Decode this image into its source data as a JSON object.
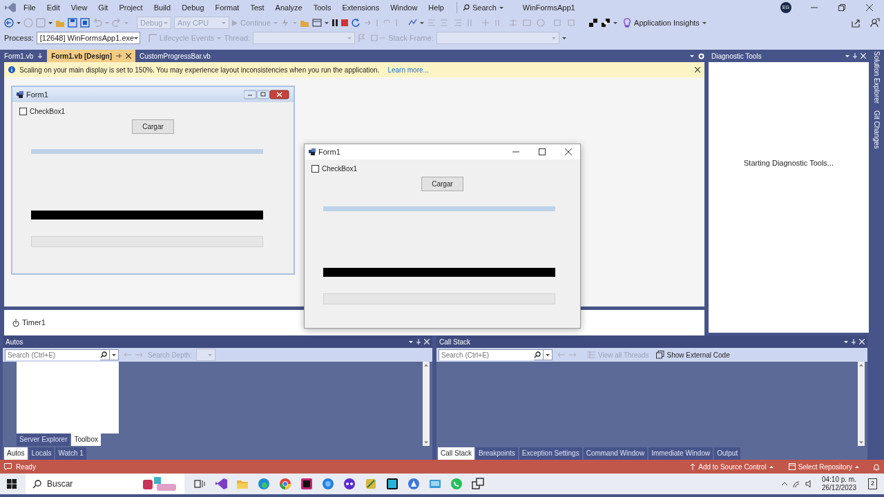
{
  "menu": [
    "File",
    "Edit",
    "View",
    "Git",
    "Project",
    "Build",
    "Debug",
    "Format",
    "Test",
    "Analyze",
    "Tools",
    "Extensions",
    "Window",
    "Help"
  ],
  "search": "Search",
  "solution": "WinFormsApp1",
  "account": "EG",
  "toolbar": {
    "config": "Debug",
    "platform": "Any CPU",
    "continue": "Continue",
    "insights": "Application Insights"
  },
  "debug_location": {
    "process_label": "Process:",
    "process": "[12648] WinFormsApp1.exe",
    "lifecycle": "Lifecycle Events",
    "thread_label": "Thread:",
    "frame_label": "Stack Frame:"
  },
  "doc_tabs": [
    {
      "label": "Form1.vb",
      "selected": false
    },
    {
      "label": "Form1.vb [Design]",
      "selected": true
    },
    {
      "label": "CustomProgressBar.vb",
      "selected": false
    }
  ],
  "info_bar": {
    "message": "Scaling on your main display is set to 150%. You may experience layout inconsistencies when you run the application.",
    "link": "Learn more..."
  },
  "designer_form": {
    "title": "Form1",
    "checkbox": {
      "label": "CheckBox1",
      "checked": false
    },
    "button": "Cargar",
    "bars": [
      {
        "kind": "thin",
        "level": 1
      },
      {
        "kind": "solid",
        "level": 1
      },
      {
        "kind": "empty",
        "level": 0
      }
    ]
  },
  "component_tray": [
    "Timer1"
  ],
  "running_form": {
    "title": "Form1",
    "checkbox": {
      "label": "CheckBox1",
      "checked": false
    },
    "button": "Cargar",
    "bars": [
      {
        "kind": "thin",
        "level": 1
      },
      {
        "kind": "solid",
        "level": 1
      },
      {
        "kind": "empty",
        "level": 0
      }
    ]
  },
  "diagnostics": {
    "title": "Diagnostic Tools",
    "message": "Starting Diagnostic Tools..."
  },
  "side_tabs": [
    "Solution Explorer",
    "Git Changes"
  ],
  "autos": {
    "title": "Autos",
    "search_placeholder": "Search (Ctrl+E)",
    "depth_label": "Search Depth:",
    "popup_tabs": [
      {
        "label": "Server Explorer",
        "selected": false
      },
      {
        "label": "Toolbox",
        "selected": true
      }
    ],
    "tabs": [
      {
        "label": "Autos",
        "selected": true
      },
      {
        "label": "Locals",
        "selected": false
      },
      {
        "label": "Watch 1",
        "selected": false
      }
    ]
  },
  "call_stack": {
    "title": "Call Stack",
    "search_placeholder": "Search (Ctrl+E)",
    "view_threads": "View all Threads",
    "external_code": "Show External Code",
    "tabs": [
      {
        "label": "Call Stack",
        "selected": true
      },
      {
        "label": "Breakpoints",
        "selected": false
      },
      {
        "label": "Exception Settings",
        "selected": false
      },
      {
        "label": "Command Window",
        "selected": false
      },
      {
        "label": "Immediate Window",
        "selected": false
      },
      {
        "label": "Output",
        "selected": false
      }
    ]
  },
  "status_bar": {
    "text": "Ready",
    "source_control": "Add to Source Control",
    "repository": "Select Repository"
  },
  "taskbar": {
    "search": "Buscar",
    "time": "04:10 p. m.",
    "date": "26/12/2023",
    "notifications": "2"
  }
}
